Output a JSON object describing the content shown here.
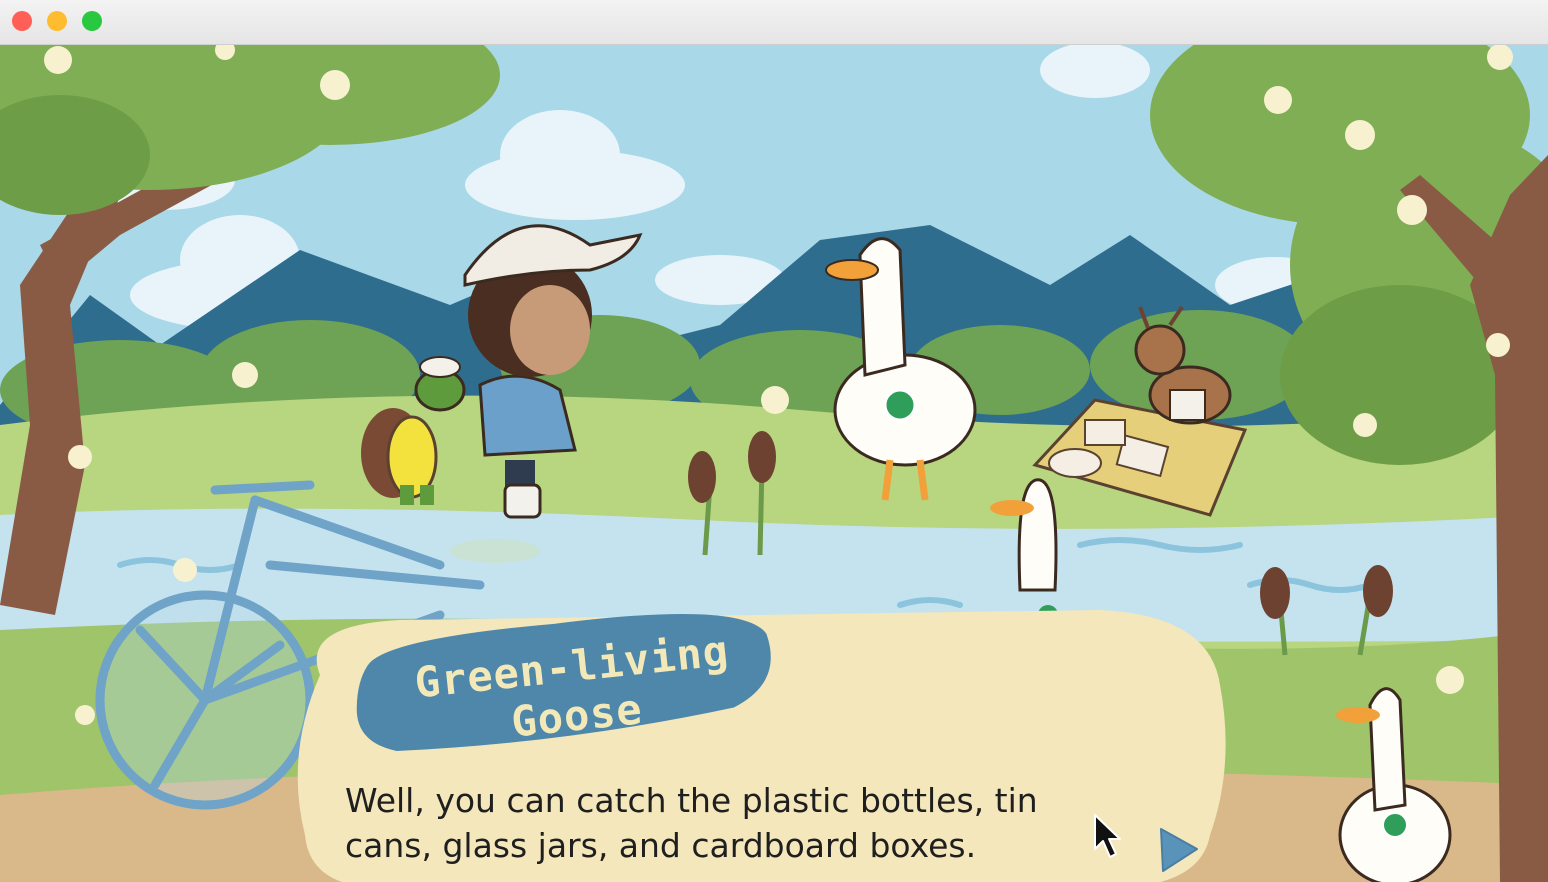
{
  "window": {
    "traffic_lights": {
      "close_color": "#fe5f57",
      "minimize_color": "#febc2e",
      "maximize_color": "#28c840"
    }
  },
  "dialog": {
    "speaker": "Green-living Goose",
    "text": "Well, you can catch the plastic bottles, tin cans, glass jars, and cardboard boxes."
  },
  "colors": {
    "sky": "#a9d8e9",
    "mountains": "#2f6d8e",
    "grass": "#b8d57f",
    "river": "#c4e3ef",
    "nameplate": "#4e87aa",
    "dialog_box": "#f3e7bb",
    "next_arrow": "#5a93ba"
  },
  "icons": {
    "next": "play-triangle-icon",
    "cursor": "mouse-pointer-icon"
  }
}
